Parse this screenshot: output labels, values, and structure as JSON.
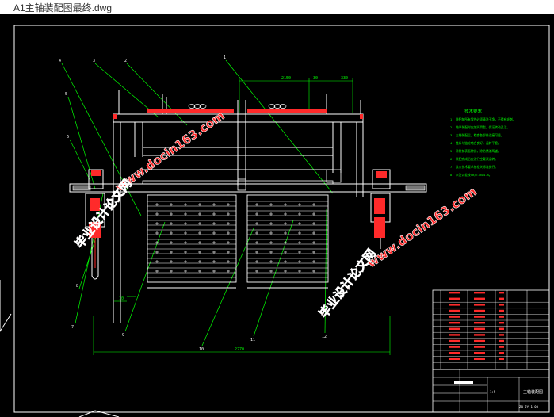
{
  "window": {
    "title": "A1主轴装配图最终.dwg"
  },
  "drawing": {
    "dimensions": {
      "top_total": "2150",
      "top_a": "30",
      "top_b": "330",
      "bottom_total": "2270",
      "left_small": "10"
    },
    "technical_notes": {
      "heading": "技术要求",
      "lines": [
        "1. 装配前所有零件必须清洗干净，不得有毛刺。",
        "2. 轴承装配时应加润滑脂，保证转动灵活。",
        "3. 主轴装配后，检查各部件连接可靠。",
        "4. 链条与链轮啮合良好，运转平稳。",
        "5. 涂装前表面除锈，涂防锈漆两道。",
        "6. 装配完成后应进行空载试运转。",
        "7. 其余技术要求按相关标准执行。",
        "8. 未注公差按GB/T1804-m。"
      ]
    },
    "title_block": {
      "name": "主轴装配图",
      "number": "ZN-JY-1-00",
      "scale": "1:5"
    },
    "watermarks": [
      {
        "site": "www.docin163.com",
        "label": "毕业设计论文网"
      },
      {
        "site": "www.docin163.com",
        "label": "毕业设计论文网"
      }
    ],
    "colors": {
      "line": "#ffffff",
      "accent": "#ff0000",
      "note": "#00ff00",
      "leader": "#00ff00",
      "dim": "#00ff00",
      "watermark": "#ff2a2a"
    }
  }
}
